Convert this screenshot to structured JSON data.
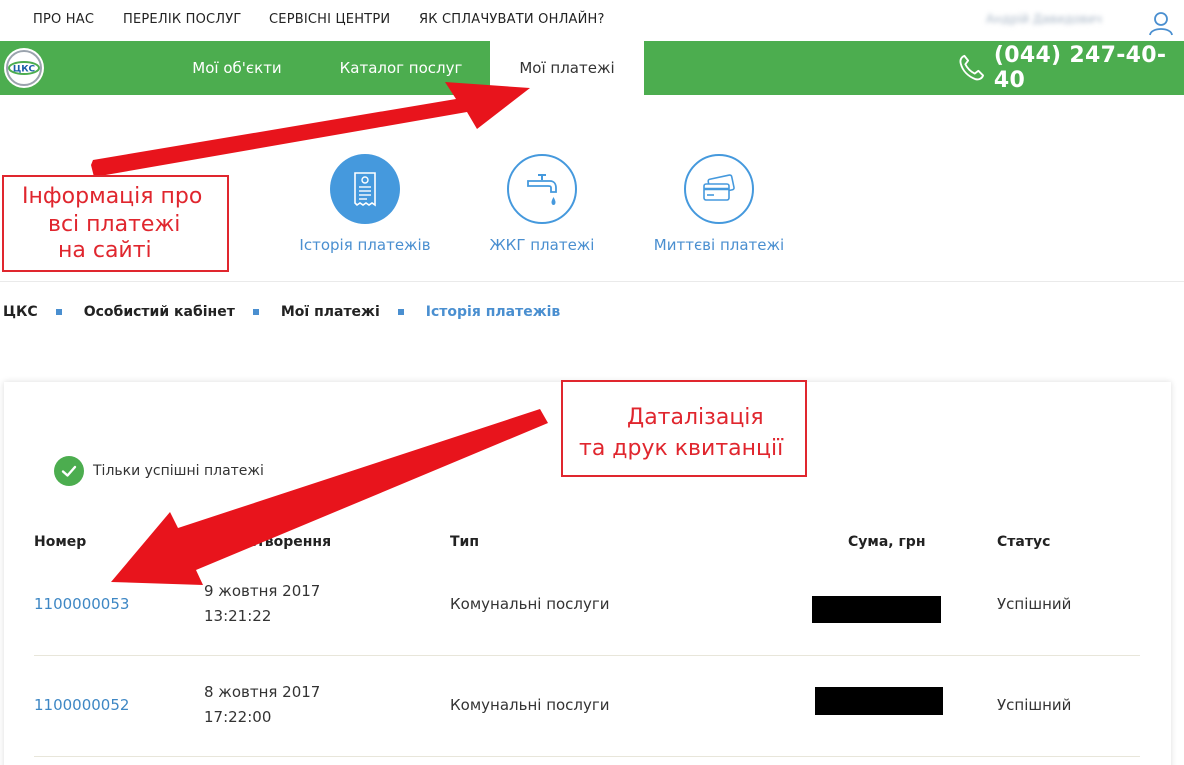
{
  "top_links": [
    "ПРО НАС",
    "ПЕРЕЛІК ПОСЛУГ",
    "СЕРВІСНІ ЦЕНТРИ",
    "ЯК СПЛАЧУВАТИ ОНЛАЙН?"
  ],
  "user": {
    "name": "Андрій Давидович"
  },
  "logo_text": "ЦКС",
  "nav": {
    "items": [
      "Мої об'єкти",
      "Каталог послуг",
      "Мої платежі"
    ],
    "active_index": 2,
    "phone": "(044) 247-40-40"
  },
  "subnav": {
    "items": [
      {
        "label": "Історія платежів",
        "icon": "receipt-icon"
      },
      {
        "label": "ЖКГ платежі",
        "icon": "faucet-icon"
      },
      {
        "label": "Миттєві платежі",
        "icon": "cards-icon"
      }
    ]
  },
  "breadcrumb": [
    "ЦКС",
    "Особистий кабінет",
    "Мої платежі",
    "Історія платежів"
  ],
  "filter": {
    "label": "Тільки успішні платежі",
    "checked": true
  },
  "table": {
    "headers": [
      "Номер",
      "Дата створення",
      "Тип",
      "Сума, грн",
      "Статус"
    ],
    "rows": [
      {
        "number": "1100000053",
        "date": "9 жовтня 2017",
        "time": "13:21:22",
        "type": "Комунальні послуги",
        "status": "Успішний"
      },
      {
        "number": "1100000052",
        "date": "8 жовтня 2017",
        "time": "17:22:00",
        "type": "Комунальні послуги",
        "status": "Успішний"
      }
    ]
  },
  "annotations": {
    "box1": [
      "Інформація про",
      "всі платежі",
      "на сайті"
    ],
    "box2": [
      "Даталізація",
      "та друк квитанції"
    ]
  },
  "colors": {
    "green": "#4cad4f",
    "blue": "#4599dd",
    "link": "#3e87c4",
    "annotation_red": "#e0262e"
  }
}
